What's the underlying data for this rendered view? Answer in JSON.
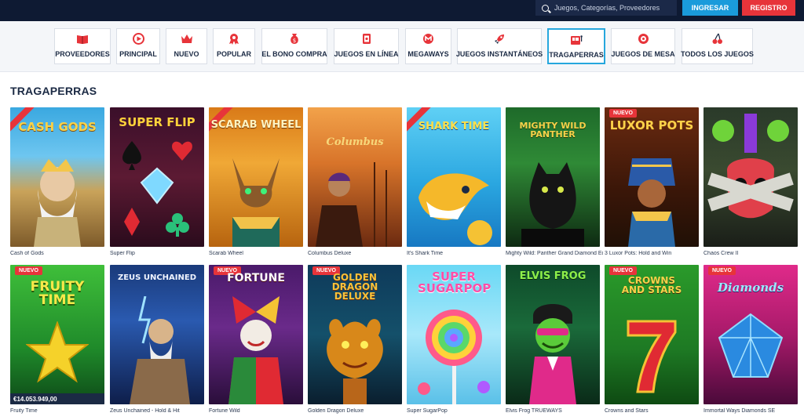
{
  "header": {
    "search_placeholder": "Juegos, Categorías, Proveedores",
    "login_label": "INGRESAR",
    "register_label": "REGISTRO"
  },
  "categories": [
    {
      "label": "PROVEEDORES",
      "icon": "book-icon"
    },
    {
      "label": "PRINCIPAL",
      "icon": "play-icon"
    },
    {
      "label": "NUEVO",
      "icon": "crown-icon"
    },
    {
      "label": "POPULAR",
      "icon": "medal-icon"
    },
    {
      "label": "EL BONO COMPRA",
      "icon": "money-bag-icon"
    },
    {
      "label": "JUEGOS EN LÍNEA",
      "icon": "cards-icon"
    },
    {
      "label": "MEGAWAYS",
      "icon": "megaways-icon"
    },
    {
      "label": "JUEGOS INSTANTÁNEOS",
      "icon": "rocket-icon"
    },
    {
      "label": "TRAGAPERRAS",
      "icon": "slot-machine-icon",
      "active": true
    },
    {
      "label": "JUEGOS DE MESA",
      "icon": "roulette-icon"
    },
    {
      "label": "TODOS LOS JUEGOS",
      "icon": "cherry-icon"
    }
  ],
  "section": {
    "title": "TRAGAPERRAS"
  },
  "games": [
    {
      "name": "Cash of Gods",
      "logo": "CASH GODS",
      "badge": "",
      "jackpot": ""
    },
    {
      "name": "Super Flip",
      "logo": "SUPER FLIP",
      "badge": "",
      "jackpot": ""
    },
    {
      "name": "Scarab Wheel",
      "logo": "SCARAB WHEEL",
      "badge": "",
      "jackpot": ""
    },
    {
      "name": "Columbus Deluxe",
      "logo": "Columbus",
      "badge": "",
      "jackpot": ""
    },
    {
      "name": "It's Shark Time",
      "logo": "SHARK TIME",
      "badge": "",
      "jackpot": ""
    },
    {
      "name": "Mighty Wild: Panther Grand Diamond Ed...",
      "logo": "MIGHTY WILD PANTHER",
      "badge": "",
      "jackpot": ""
    },
    {
      "name": "3 Luxor Pots: Hold and Win",
      "logo": "LUXOR POTS",
      "badge": "NUEVO",
      "jackpot": ""
    },
    {
      "name": "Chaos Crew II",
      "logo": "",
      "badge": "",
      "jackpot": ""
    },
    {
      "name": "Fruity Time",
      "logo": "FRUITY TIME",
      "badge": "NUEVO",
      "jackpot": "€14.053.949,00"
    },
    {
      "name": "Zeus Unchained - Hold & Hit",
      "logo": "ZEUS UNCHAINED",
      "badge": "",
      "jackpot": ""
    },
    {
      "name": "Fortune Wild",
      "logo": "FORTUNE",
      "badge": "NUEVO",
      "jackpot": ""
    },
    {
      "name": "Golden Dragon Deluxe",
      "logo": "GOLDEN DRAGON DELUXE",
      "badge": "NUEVO",
      "jackpot": ""
    },
    {
      "name": "Super SugarPop",
      "logo": "SUPER SUGARPOP",
      "badge": "",
      "jackpot": ""
    },
    {
      "name": "Elvis Frog TRUEWAYS",
      "logo": "ELVIS FROG",
      "badge": "",
      "jackpot": ""
    },
    {
      "name": "Crowns and Stars",
      "logo": "CROWNS AND STARS",
      "badge": "NUEVO",
      "jackpot": ""
    },
    {
      "name": "Immortal Ways Diamonds SE",
      "logo": "Diamonds",
      "badge": "NUEVO",
      "jackpot": ""
    }
  ]
}
